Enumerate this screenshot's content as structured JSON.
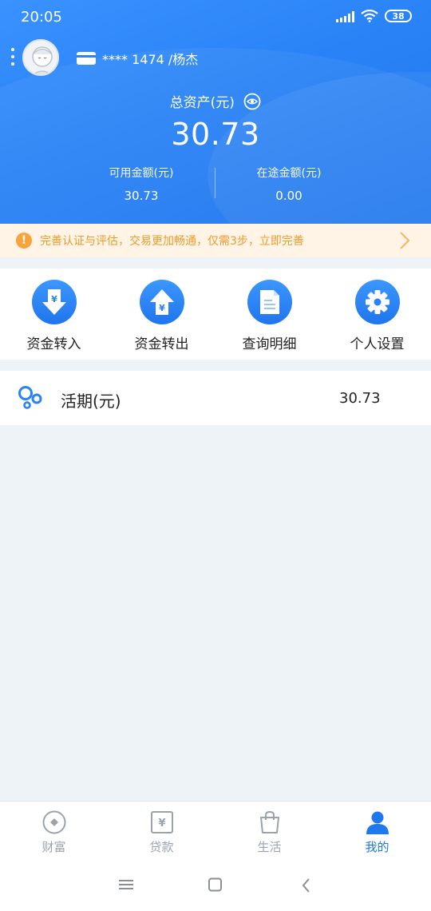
{
  "status_bar": {
    "time": "20:05",
    "battery": "38"
  },
  "account": {
    "masked": "**** 1474 /杨杰"
  },
  "assets": {
    "total_label": "总资产(元)",
    "total_value": "30.73",
    "available_label": "可用金额(元)",
    "available_value": "30.73",
    "in_transit_label": "在途金额(元)",
    "in_transit_value": "0.00"
  },
  "notice": {
    "icon": "exclamation-icon",
    "text": "完善认证与评估，交易更加畅通，仅需3步，立即完善"
  },
  "actions": [
    {
      "label": "资金转入",
      "icon": "transfer-in-icon"
    },
    {
      "label": "资金转出",
      "icon": "transfer-out-icon"
    },
    {
      "label": "查询明细",
      "icon": "document-icon"
    },
    {
      "label": "个人设置",
      "icon": "gear-icon"
    }
  ],
  "deposit": {
    "label": "活期(元)",
    "value": "30.73"
  },
  "bottom_nav": [
    {
      "label": "财富",
      "icon": "wealth-icon",
      "active": false
    },
    {
      "label": "贷款",
      "icon": "loan-icon",
      "active": false
    },
    {
      "label": "生活",
      "icon": "shopping-bag-icon",
      "active": false
    },
    {
      "label": "我的",
      "icon": "profile-icon",
      "active": true
    }
  ],
  "colors": {
    "primary": "#2a83f6",
    "notice_text": "#f09a2c",
    "notice_bg": "#fff4e5",
    "active_nav": "#1e78ee"
  }
}
